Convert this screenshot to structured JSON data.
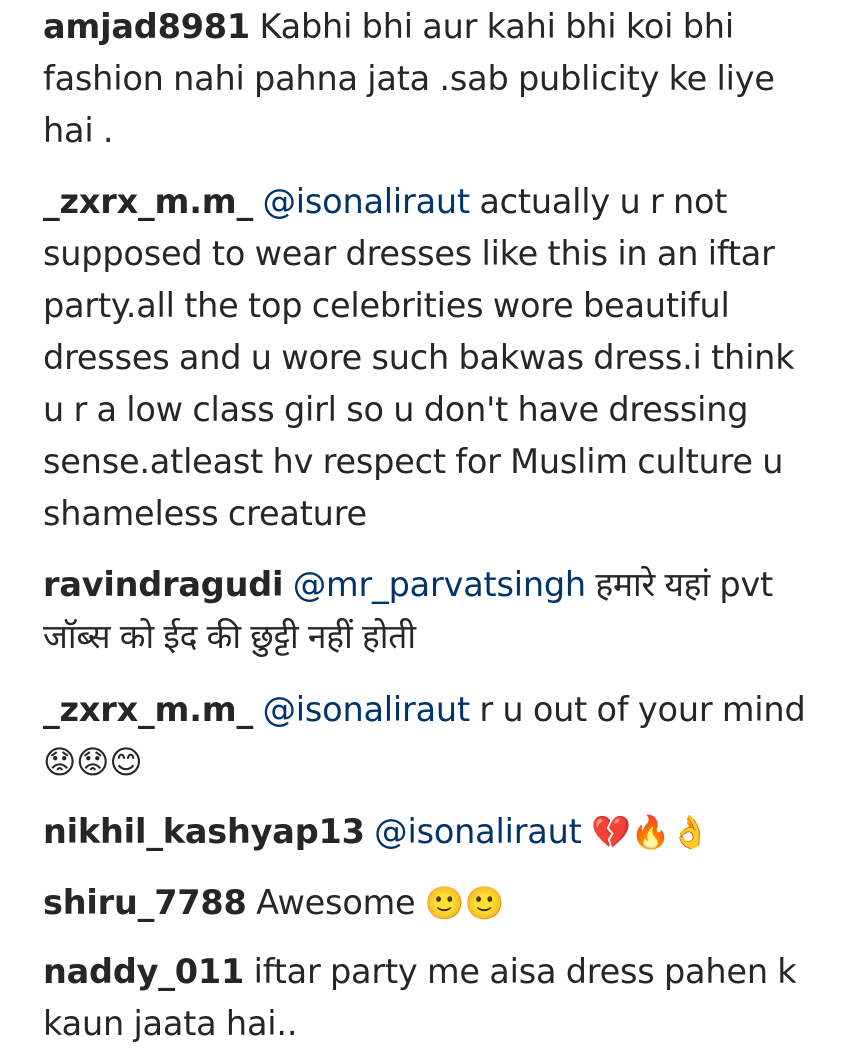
{
  "comments": [
    {
      "username": "amjad8981",
      "mention": "",
      "text": "Kabhi bhi aur kahi bhi koi bhi fashion nahi pahna jata .sab publicity ke liye hai .",
      "emoji": ""
    },
    {
      "username": "_zxrx_m.m_",
      "mention": "@isonaliraut",
      "text": "actually u r not supposed to wear dresses like this in an iftar party.all the top celebrities wore beautiful dresses and u wore such bakwas dress.i think u r a low class girl so u don't have dressing sense.atleast hv respect for Muslim culture u shameless creature",
      "emoji": ""
    },
    {
      "username": "ravindragudi",
      "mention": "@mr_parvatsingh",
      "text": "हमारे यहां pvt जॉब्स को ईद की छुट्टी नहीं होती",
      "emoji": ""
    },
    {
      "username": "_zxrx_m.m_",
      "mention": "@isonaliraut",
      "text": "r u out of your mind",
      "emoji": "😟😟😊"
    },
    {
      "username": "nikhil_kashyap13",
      "mention": "@isonaliraut",
      "text": "",
      "emoji": "💔🔥👌"
    },
    {
      "username": "shiru_7788",
      "mention": "",
      "text": "Awesome",
      "emoji": "🙂🙂"
    },
    {
      "username": "naddy_011",
      "mention": "",
      "text": "iftar party me aisa dress pahen k kaun jaata hai..",
      "emoji": ""
    }
  ]
}
